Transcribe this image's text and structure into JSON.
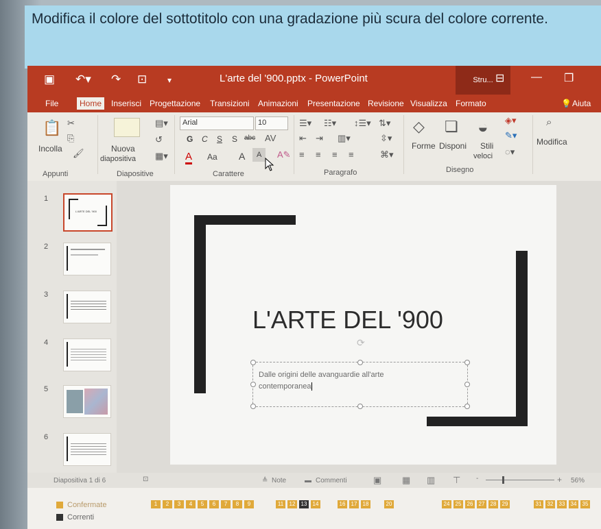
{
  "instruction": "Modifica il colore del sottotitolo con una gradazione più scura del colore corrente.",
  "titlebar": {
    "doc_title": "L'arte del '900.pptx - PowerPoint",
    "context_tab": "Stru...",
    "help_label": "Aiuta"
  },
  "tabs": [
    "File",
    "Home",
    "Inserisci",
    "Progettazione",
    "Transizioni",
    "Animazioni",
    "Presentazione",
    "Revisione",
    "Visualizza",
    "Formato"
  ],
  "ribbon": {
    "paste_label": "Incolla",
    "clipboard_group": "Appunti",
    "new_slide_label": "Nuova",
    "new_slide_label2": "diapositiva",
    "slides_group": "Diapositive",
    "font_name": "Arial",
    "font_size": "10",
    "bold": "G",
    "italic": "C",
    "underline": "S",
    "shadow": "S",
    "strikethrough": "abc",
    "change_case": "Aa",
    "grow_font": "A",
    "shrink_font": "A",
    "font_group": "Carattere",
    "paragraph_group": "Paragrafo",
    "shapes_label": "Forme",
    "arrange_label": "Disponi",
    "quick_styles_label": "Stili",
    "quick_styles_label2": "veloci",
    "drawing_group": "Disegno",
    "edit_label": "Modifica"
  },
  "thumbnails": [
    "1",
    "2",
    "3",
    "4",
    "5",
    "6"
  ],
  "thumb1_text": "L'ARTE DEL '900",
  "slide": {
    "title": "L'ARTE DEL '900",
    "subtitle_line1": "Dalle origini delle avanguardie all'arte",
    "subtitle_line2": "contemporanea"
  },
  "statusbar": {
    "slide_counter": "Diapositiva 1 di 6",
    "notes": "Note",
    "comments": "Commenti",
    "zoom": "56%",
    "zoom_plus": "+",
    "zoom_minus": "-"
  },
  "legend": {
    "confirmed": "Confermate",
    "current": "Correnti"
  },
  "progress_squares": [
    "1",
    "2",
    "3",
    "4",
    "5",
    "6",
    "7",
    "8",
    "9",
    "11",
    "12",
    "13",
    "14",
    "16",
    "17",
    "18",
    "20",
    "24",
    "25",
    "26",
    "27",
    "28",
    "29",
    "31",
    "32",
    "33",
    "34",
    "35"
  ],
  "current_square": "13",
  "colors": {
    "accent": "#b83b22",
    "instruction_bg": "#a9d8ec",
    "confirmed": "#e0a93a",
    "current": "#333333"
  }
}
